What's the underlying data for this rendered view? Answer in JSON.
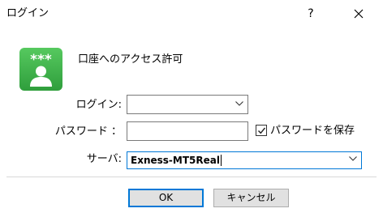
{
  "window": {
    "title": "ログイン",
    "help_glyph": "?",
    "close_icon": "close-icon"
  },
  "icon": {
    "name": "account-icon",
    "badge_text": "***",
    "color": "#3bb34a"
  },
  "form": {
    "heading": "口座へのアクセス許可",
    "login_label": "ログイン:",
    "login_value": "",
    "password_label": "パスワード ：",
    "password_value": "",
    "save_password_label": "パスワードを保存",
    "save_password_checked": true,
    "server_label": "サーバ:",
    "server_value": "Exness-MT5Real"
  },
  "buttons": {
    "ok": "OK",
    "cancel": "キャンセル"
  },
  "colors": {
    "focus": "#0078d7",
    "button_bg": "#e1e1e1"
  }
}
